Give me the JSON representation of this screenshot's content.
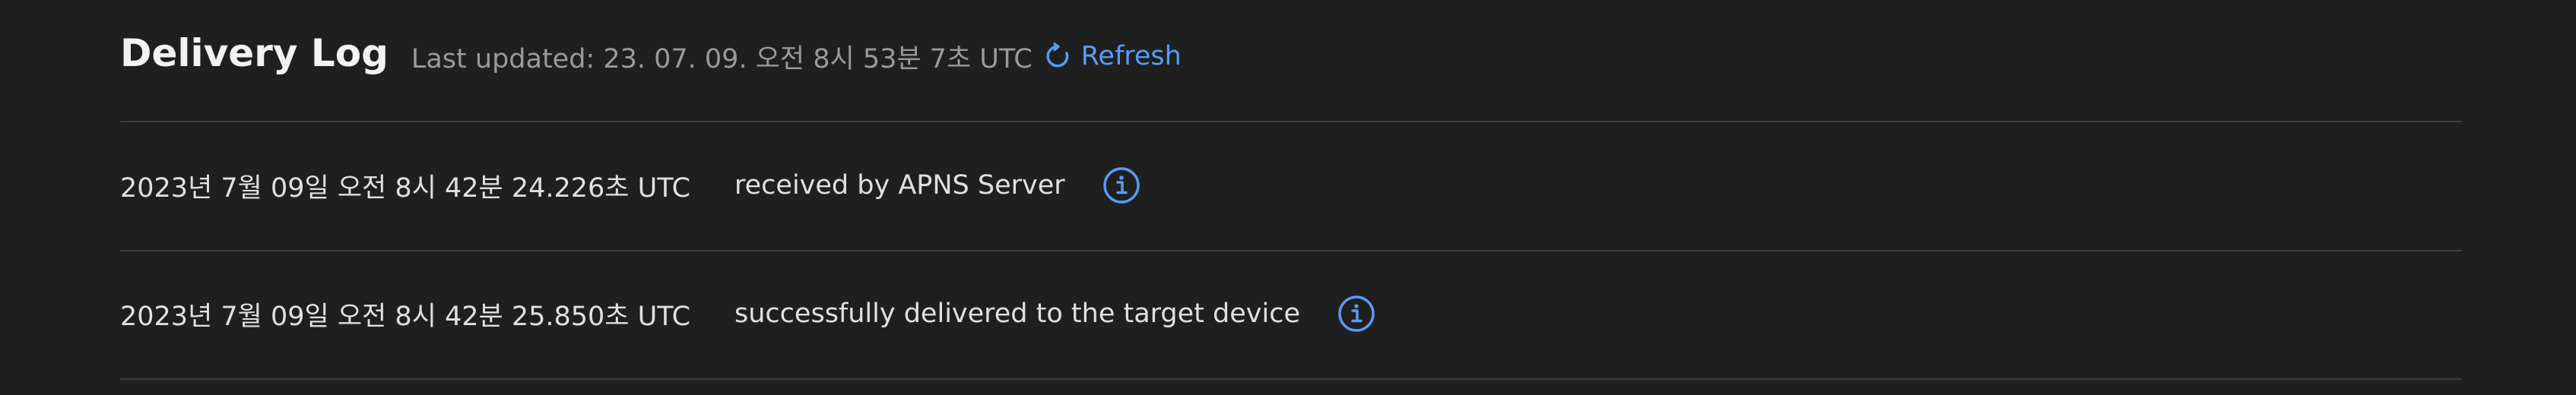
{
  "header": {
    "title": "Delivery Log",
    "last_updated": "Last updated: 23. 07. 09. 오전 8시 53분 7초 UTC",
    "refresh_label": "Refresh",
    "refresh_icon": "refresh-icon"
  },
  "entries": [
    {
      "timestamp": "2023년 7월 09일 오전 8시 42분 24.226초 UTC",
      "status": "received by APNS Server",
      "icon": "info-icon"
    },
    {
      "timestamp": "2023년 7월 09일 오전 8시 42분 25.850초 UTC",
      "status": "successfully delivered to the target device",
      "icon": "info-icon"
    }
  ],
  "colors": {
    "background": "#1f1f1f",
    "accent": "#5a9bf5",
    "divider": "#3e3e3e",
    "muted_text": "#9a9a9a"
  }
}
